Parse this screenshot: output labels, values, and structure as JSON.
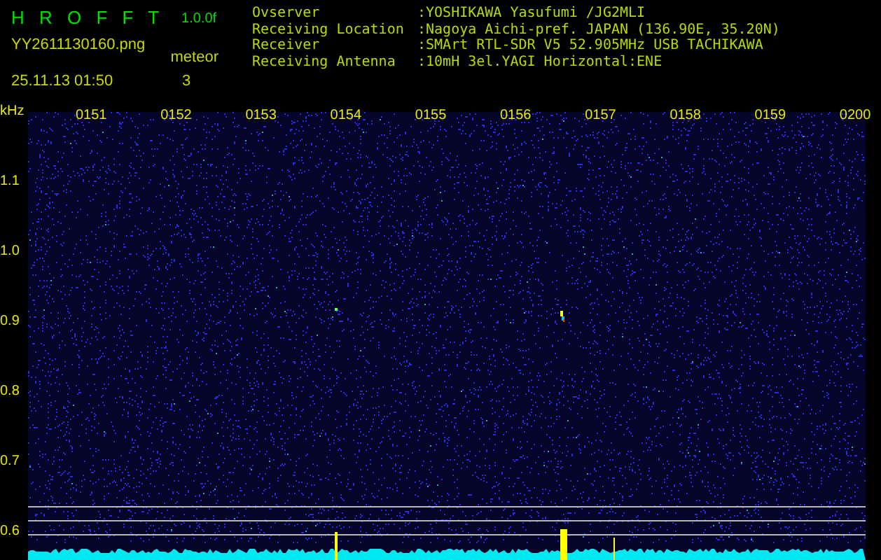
{
  "header": {
    "title": "H R O F F T",
    "version": "1.0.0f",
    "filename": "YY2611130160.png",
    "datetime": "25.11.13 01:50",
    "detection_label": "meteor",
    "detection_count": "3",
    "info": [
      {
        "label": "Ovserver",
        "value": ":YOSHIKAWA Yasufumi /JG2MLI"
      },
      {
        "label": "Receiving Location",
        "value": ":Nagoya Aichi-pref. JAPAN (136.90E, 35.20N)"
      },
      {
        "label": "Receiver",
        "value": ":SMArt RTL-SDR V5 52.905MHz USB TACHIKAWA"
      },
      {
        "label": "Receiving Antenna",
        "value": ":10mH 3el.YAGI Horizontal:ENE"
      }
    ]
  },
  "spectrogram": {
    "unit": "kHz",
    "time_labels": [
      "0151",
      "0152",
      "0153",
      "0154",
      "0155",
      "0156",
      "0157",
      "0158",
      "0159",
      "0200"
    ],
    "freq_labels": [
      "1.1",
      "1.0",
      "0.9",
      "0.8",
      "0.7",
      "0.6"
    ]
  }
}
